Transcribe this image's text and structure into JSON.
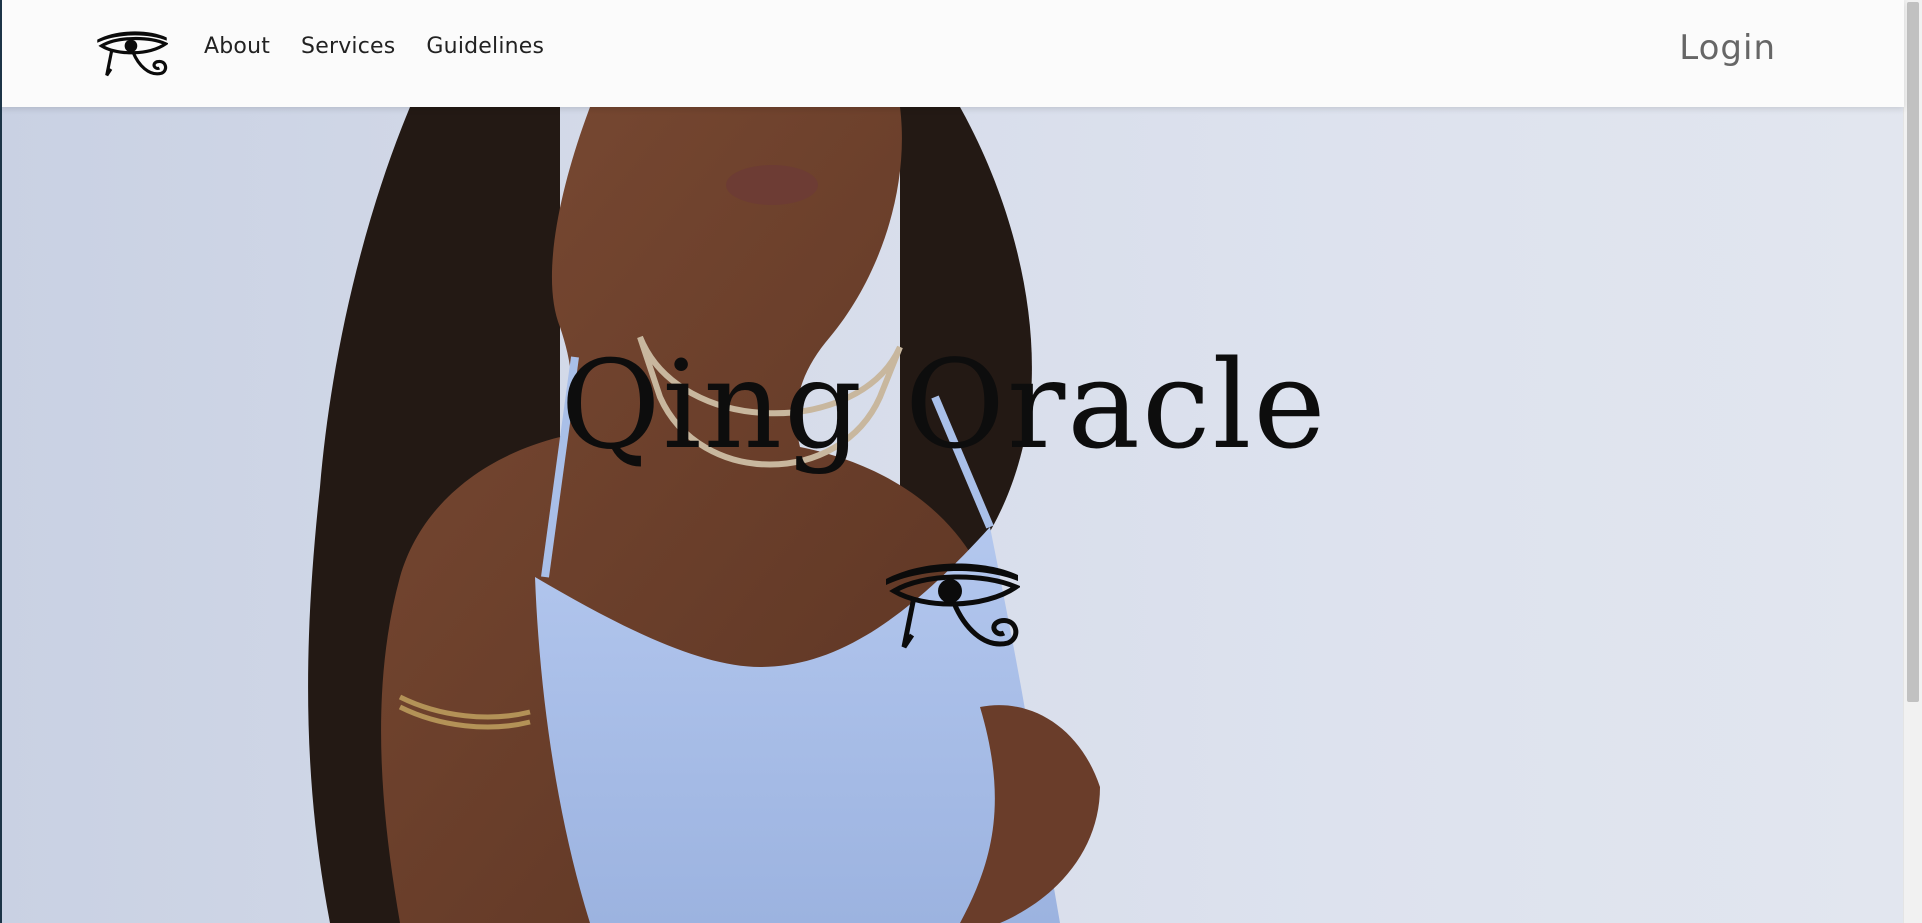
{
  "nav": {
    "logo_icon": "eye-of-horus-icon",
    "links": [
      "About",
      "Services",
      "Guidelines"
    ],
    "login": "Login"
  },
  "hero": {
    "title": "Qing Oracle",
    "emblem_icon": "eye-of-horus-icon"
  },
  "colors": {
    "navbar_bg": "#fbfbfb",
    "hero_bg": "#d6dcea",
    "dress": "#a9bfe8",
    "title": "#0d0d0d",
    "login": "#666666"
  }
}
